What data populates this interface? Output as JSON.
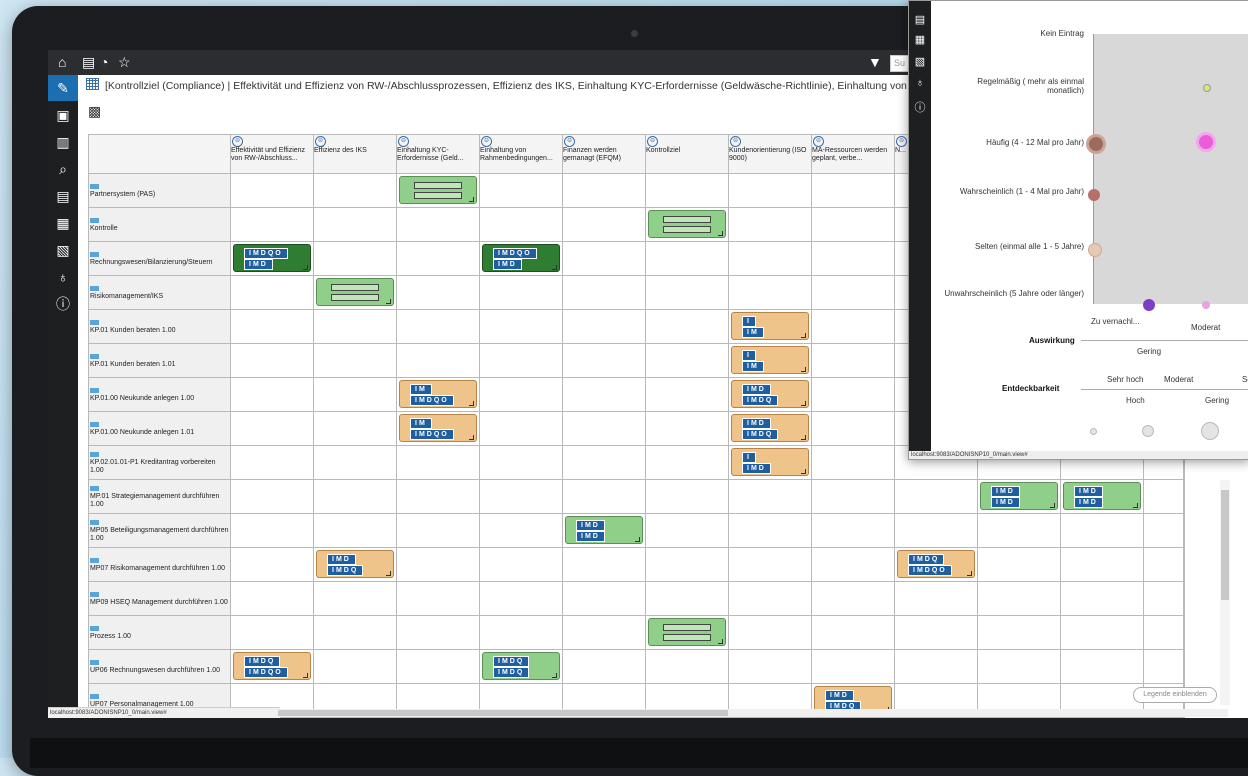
{
  "colors": {
    "accent": "#1b6fb0",
    "green": "#8fcf8a",
    "dark_green": "#2f7d32",
    "orange": "#efc48a",
    "pink": "#e85ed8",
    "purple": "#7b3fc4"
  },
  "search": {
    "placeholder": "Su"
  },
  "breadcrumb": "[Kontrollziel (Compliance) | Effektivität und Effizienz von RW-/Abschlussprozessen, Effizienz des IKS, Einhaltung KYC-Erfordernisse (Geldwäsche-Richtlinie), Einhaltung von Rahmenbedingungen im RW",
  "topbar_icons": [
    "home-icon",
    "new-document-icon",
    "find-icon",
    "favorite-icon",
    "filter-icon"
  ],
  "sidebar_icons": [
    "edit-icon",
    "document-check-icon",
    "book-icon",
    "search-icon",
    "list-icon",
    "card-icon",
    "report-icon",
    "bulb-icon",
    "info-icon"
  ],
  "columns": [
    "Effektivität und Effizienz von RW-/Abschluss...",
    "Effizienz des IKS",
    "Einhaltung KYC-Erfordernisse (Geld...",
    "Einhaltung von Rahmenbedingungen...",
    "Finanzen werden gemanagt (EFQM)",
    "Kontrollziel",
    "Kundenorientierung (ISO 9000)",
    "MA-Ressourcen werden geplant, verbe...",
    "N... IK...",
    "",
    "",
    ""
  ],
  "rows": [
    {
      "label": "Partnersystem (PAS)",
      "cells": [
        null,
        null,
        "green",
        null,
        null,
        null,
        null,
        null,
        null,
        null,
        null,
        null
      ]
    },
    {
      "label": "Kontrolle",
      "cells": [
        null,
        null,
        null,
        null,
        null,
        "green",
        null,
        null,
        null,
        null,
        null,
        null
      ]
    },
    {
      "label": "Rechnungswesen/Bilanzierung/Steuern",
      "cells": [
        {
          "c": "dgreen",
          "l1": "IMDQO",
          "l2": "IMD"
        },
        null,
        null,
        {
          "c": "dgreen",
          "l1": "IMDQO",
          "l2": "IMD"
        },
        null,
        null,
        null,
        null,
        null,
        null,
        null,
        null
      ]
    },
    {
      "label": "Risikomanagement/IKS",
      "cells": [
        null,
        "green",
        null,
        null,
        null,
        null,
        null,
        null,
        null,
        null,
        null,
        null
      ]
    },
    {
      "label": "KP.01 Kunden beraten 1.00",
      "cells": [
        null,
        null,
        null,
        null,
        null,
        null,
        {
          "c": "orange",
          "l1": "I",
          "l2": "IM"
        },
        null,
        null,
        null,
        null,
        null
      ]
    },
    {
      "label": "KP.01 Kunden beraten 1.01",
      "cells": [
        null,
        null,
        null,
        null,
        null,
        null,
        {
          "c": "orange",
          "l1": "I",
          "l2": "IM"
        },
        null,
        null,
        null,
        null,
        null
      ]
    },
    {
      "label": "KP.01.00 Neukunde anlegen 1.00",
      "cells": [
        null,
        null,
        {
          "c": "orange",
          "l1": "IM",
          "l2": "IMDQO"
        },
        null,
        null,
        null,
        {
          "c": "orange",
          "l1": "IMD",
          "l2": "IMDQ"
        },
        null,
        null,
        null,
        null,
        null
      ]
    },
    {
      "label": "KP.01.00 Neukunde anlegen 1.01",
      "cells": [
        null,
        null,
        {
          "c": "orange",
          "l1": "IM",
          "l2": "IMDQO"
        },
        null,
        null,
        null,
        {
          "c": "orange",
          "l1": "IMD",
          "l2": "IMDQ"
        },
        null,
        null,
        null,
        null,
        null
      ]
    },
    {
      "label": "KP.02.01.01-P1 Kreditantrag vorbereiten 1.00",
      "cells": [
        null,
        null,
        null,
        null,
        null,
        null,
        {
          "c": "orange",
          "l1": "I",
          "l2": "IMD"
        },
        null,
        null,
        null,
        null,
        null
      ]
    },
    {
      "label": "MP.01 Strategiemanagement durchführen 1.00",
      "cells": [
        null,
        null,
        null,
        null,
        null,
        null,
        null,
        null,
        null,
        {
          "c": "green",
          "l1": "IMD",
          "l2": "IMD"
        },
        {
          "c": "green",
          "l1": "IMD",
          "l2": "IMD"
        },
        null
      ]
    },
    {
      "label": "MP05 Beteiligungsmanagement durchführen 1.00",
      "cells": [
        null,
        null,
        null,
        null,
        {
          "c": "green",
          "l1": "IMD",
          "l2": "IMD"
        },
        null,
        null,
        null,
        null,
        null,
        null,
        null
      ]
    },
    {
      "label": "MP07 Risikomanagement durchführen 1.00",
      "cells": [
        null,
        {
          "c": "orange",
          "l1": "IMD",
          "l2": "IMDQ"
        },
        null,
        null,
        null,
        null,
        null,
        null,
        {
          "c": "orange",
          "l1": "IMDQ",
          "l2": "IMDQO"
        },
        null,
        null,
        null
      ]
    },
    {
      "label": "MP09 HSEQ Management durchführen 1.00",
      "cells": [
        null,
        null,
        null,
        null,
        null,
        null,
        null,
        null,
        null,
        null,
        null,
        null
      ]
    },
    {
      "label": "Prozess 1.00",
      "cells": [
        null,
        null,
        null,
        null,
        null,
        "green",
        null,
        null,
        null,
        null,
        null,
        null
      ]
    },
    {
      "label": "UP06 Rechnungswesen durchführen 1.00",
      "cells": [
        {
          "c": "orange",
          "l1": "IMDQ",
          "l2": "IMDQO"
        },
        null,
        null,
        {
          "c": "green",
          "l1": "IMDQ",
          "l2": "IMDQ"
        },
        null,
        null,
        null,
        null,
        null,
        null,
        null,
        null
      ]
    },
    {
      "label": "UP07 Personalmanagement 1.00",
      "cells": [
        null,
        null,
        null,
        null,
        null,
        null,
        null,
        {
          "c": "orange",
          "l1": "IMD",
          "l2": "IMDQ"
        },
        null,
        null,
        null,
        null
      ]
    }
  ],
  "legend_button": "Legende einblenden",
  "status_url": "localhost:9083/ADONISNP10_0/main.view#",
  "popup": {
    "y_labels": [
      "Kein Eintrag",
      "Regelmäßig ( mehr als einmal monatlich)",
      "Häufig (4 - 12 Mal pro Jahr)",
      "Wahrscheinlich (1 - 4 Mal pro Jahr)",
      "Selten (einmal alle 1 - 5 Jahre)",
      "Unwahrscheinlich (5 Jahre oder länger)"
    ],
    "x_labels": [
      "Zu vernachl...",
      "Moderat"
    ],
    "x_labels_low": [
      "Gering"
    ],
    "auswirkung_title": "Auswirkung",
    "entdeckbarkeit_title": "Entdeckbarkeit",
    "entdeck_labels": [
      "Sehr hoch",
      "Moderat",
      "Se"
    ],
    "entdeck_labels_low": [
      "Hoch",
      "Gering"
    ],
    "status_url": "localhost:9083/ADONISNP10_0/main.view#"
  }
}
